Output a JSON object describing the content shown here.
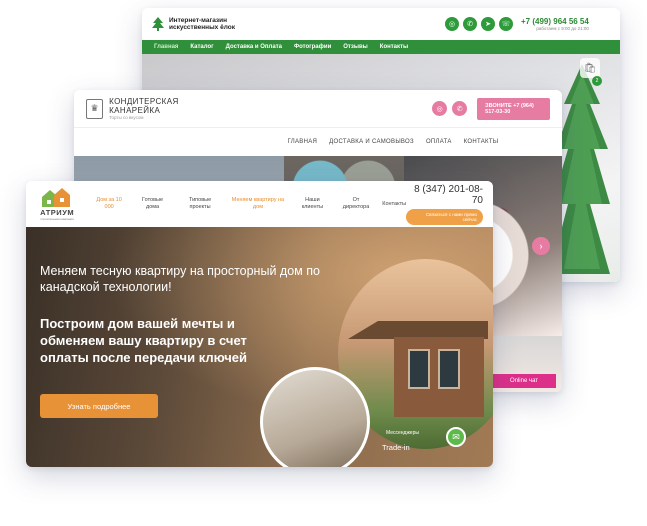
{
  "trees": {
    "title": "Интернет-магазин искусственных ёлок",
    "phone": "+7 (499) 964 56 54",
    "hours": "работаем с 9:00 до 21:00",
    "nav": [
      "Главная",
      "Каталог",
      "Доставка и Оплата",
      "Фотографии",
      "Отзывы",
      "Контакты"
    ],
    "cart_count": "2"
  },
  "cake": {
    "title": "КОНДИТЕРСКАЯ КАНАРЕЙКА",
    "subtitle": "Торты со вкусом",
    "call": "ЗВОНИТЕ +7 (964) 517-03-30",
    "nav": [
      "ГЛАВНАЯ",
      "ДОСТАВКА И САМОВЫВОЗ",
      "ОПЛАТА",
      "КОНТАКТЫ"
    ],
    "chat": "Online чат"
  },
  "atrium": {
    "logo_name": "АТРИУМ",
    "logo_sub": "строительная компания",
    "nav": [
      "Дом за 10 000",
      "Готовые дома",
      "Типовые проекты",
      "Меняем квартиру на дом",
      "Наши клиенты",
      "От директора",
      "Контакты"
    ],
    "phone": "8 (347) 201-08-70",
    "callback": "Связаться с нами прямо сейчас",
    "headline": "Меняем тесную квартиру на просторный дом по канадской технологии!",
    "subheadline": "Построим дом вашей мечты и обменяем вашу квартиру в счет оплаты после передачи ключей",
    "button": "Узнать подробнее",
    "messengers": "Мессенджеры",
    "tradein": "Trade-in"
  },
  "colors": {
    "green": "#2f8f3a",
    "pink": "#e77ca3",
    "orange": "#e89238"
  }
}
